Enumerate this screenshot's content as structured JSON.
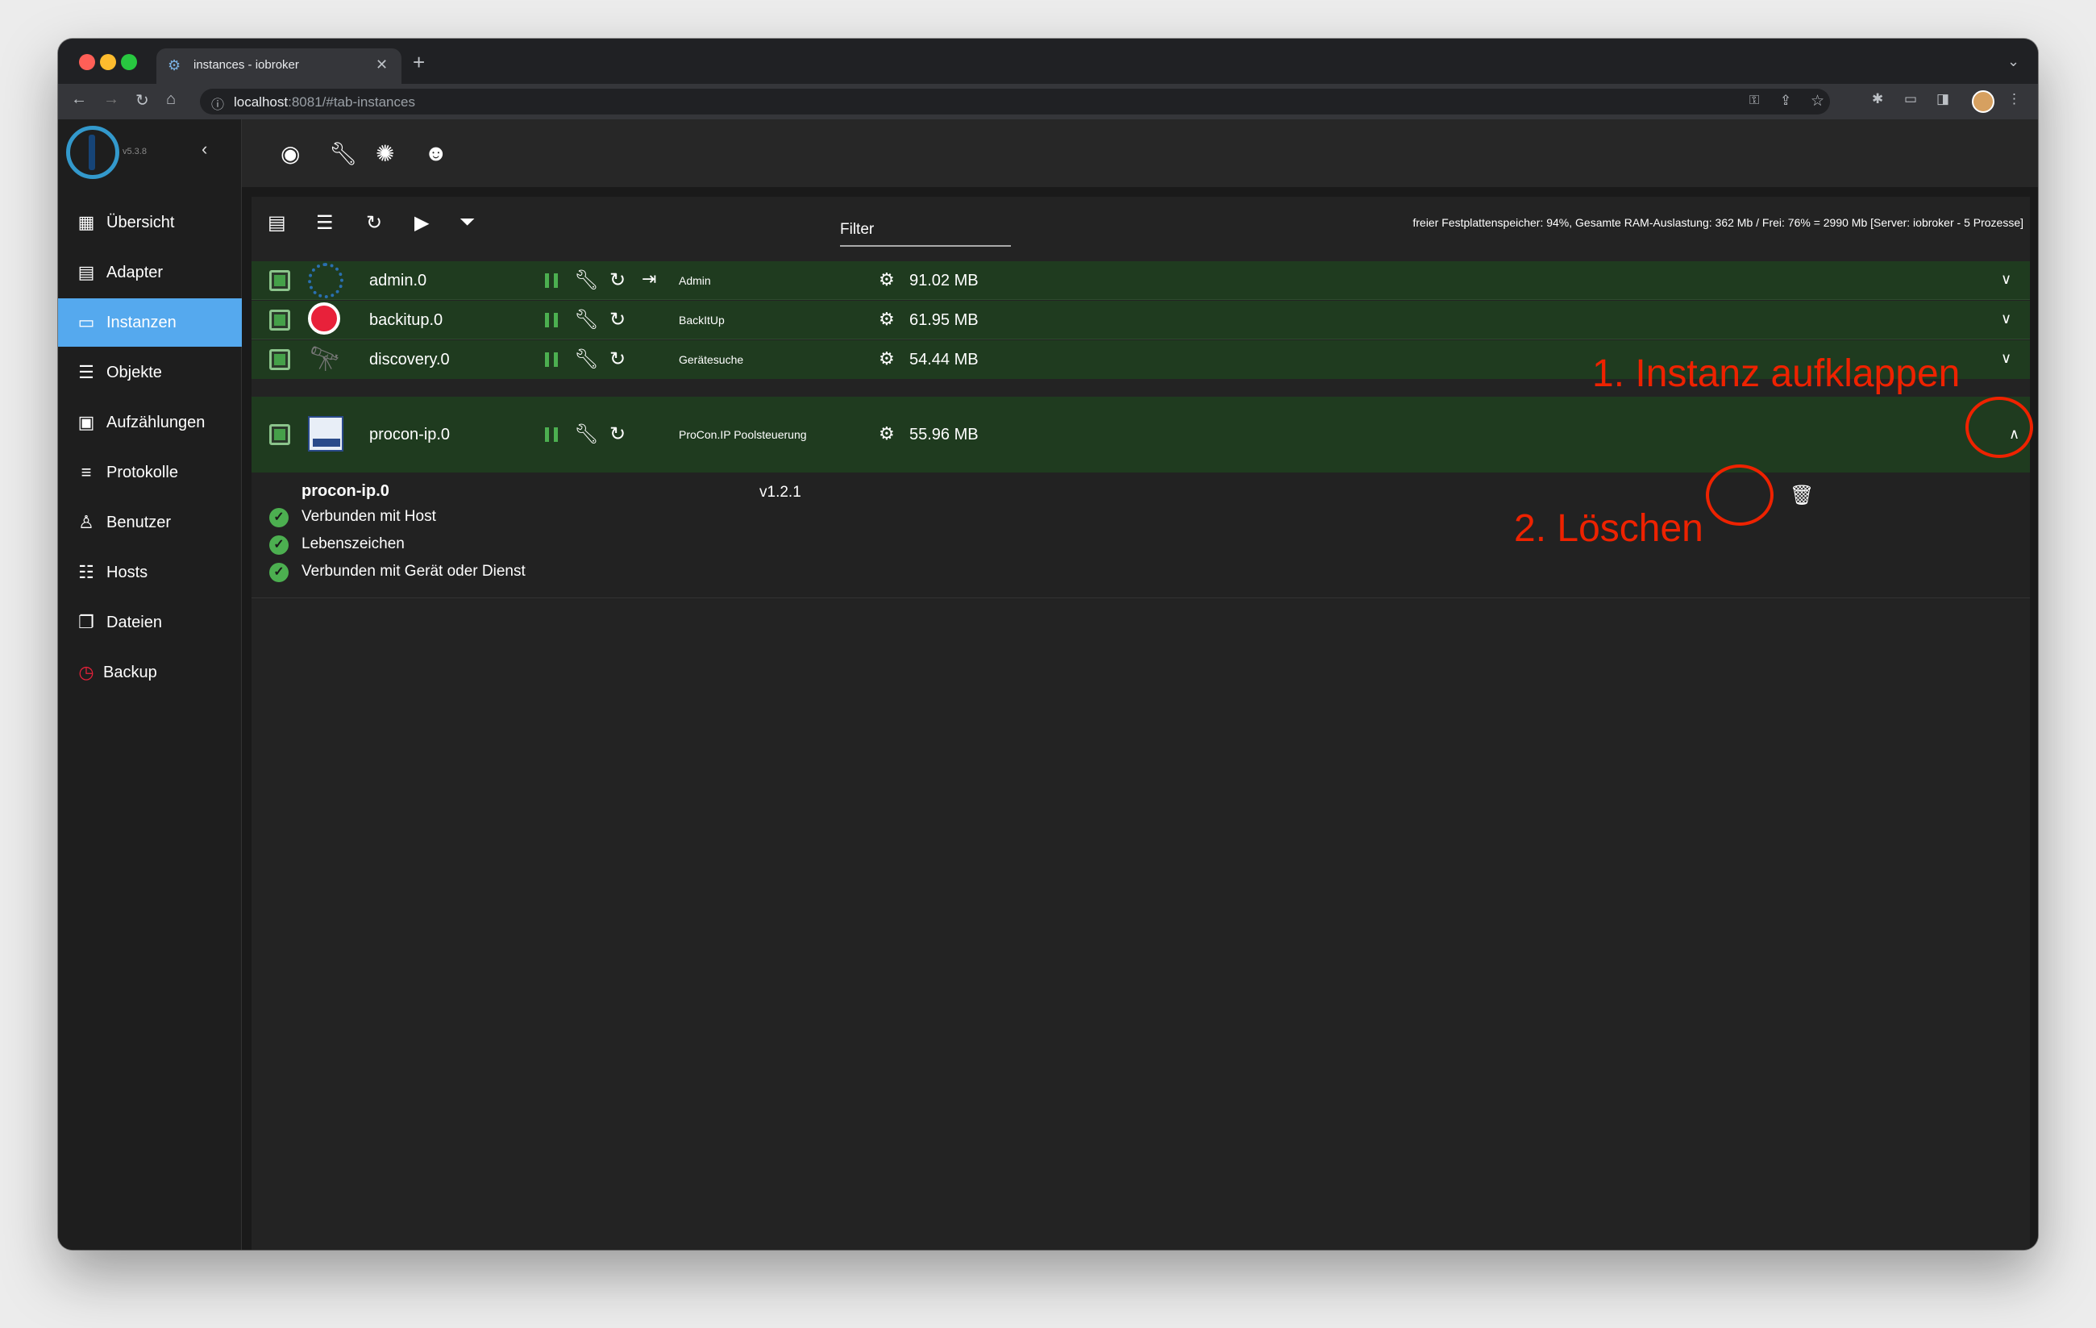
{
  "browser": {
    "tab_title": "instances - iobroker",
    "tab_close": "✕",
    "new_tab": "+",
    "url_host": "localhost",
    "url_rest": ":8081/#tab-instances"
  },
  "app": {
    "version": "v5.3.8"
  },
  "sidebar": {
    "items": [
      {
        "label": "Übersicht",
        "icon": "grid-icon"
      },
      {
        "label": "Adapter",
        "icon": "store-icon"
      },
      {
        "label": "Instanzen",
        "icon": "instances-icon",
        "active": true
      },
      {
        "label": "Objekte",
        "icon": "list-icon"
      },
      {
        "label": "Aufzählungen",
        "icon": "enum-icon"
      },
      {
        "label": "Protokolle",
        "icon": "lines-icon"
      },
      {
        "label": "Benutzer",
        "icon": "user-icon"
      },
      {
        "label": "Hosts",
        "icon": "hosts-icon"
      },
      {
        "label": "Dateien",
        "icon": "files-icon"
      },
      {
        "label": "Backup",
        "icon": "backup-icon"
      }
    ]
  },
  "panel": {
    "filter_label": "Filter",
    "system_info": "freier Festplattenspeicher: 94%, Gesamte RAM-Auslastung: 362 Mb / Frei: 76% = 2990 Mb [Server: iobroker - 5 Prozesse]"
  },
  "instances": [
    {
      "name": "admin.0",
      "title": "Admin",
      "memory": "91.02 MB",
      "icon_color": "#2a6fb0"
    },
    {
      "name": "backitup.0",
      "title": "BackItUp",
      "memory": "61.95 MB",
      "icon_color": "#e8213a"
    },
    {
      "name": "discovery.0",
      "title": "Gerätesuche",
      "memory": "54.44 MB",
      "icon_color": "#555555"
    },
    {
      "name": "procon-ip.0",
      "title": "ProCon.IP Poolsteuerung",
      "memory": "55.96 MB",
      "icon_color": "#2a4a8a"
    }
  ],
  "expanded": {
    "name": "procon-ip.0",
    "version": "v1.2.1",
    "statuses": [
      "Verbunden mit Host",
      "Lebenszeichen",
      "Verbunden mit Gerät oder Dienst"
    ]
  },
  "annotations": {
    "step1": "1. Instanz aufklappen",
    "step2": "2. Löschen"
  },
  "colors": {
    "accent": "#55a9ee",
    "row_bg": "#1f3b1f",
    "annotation": "#ee2200",
    "ok": "#4caf50"
  }
}
